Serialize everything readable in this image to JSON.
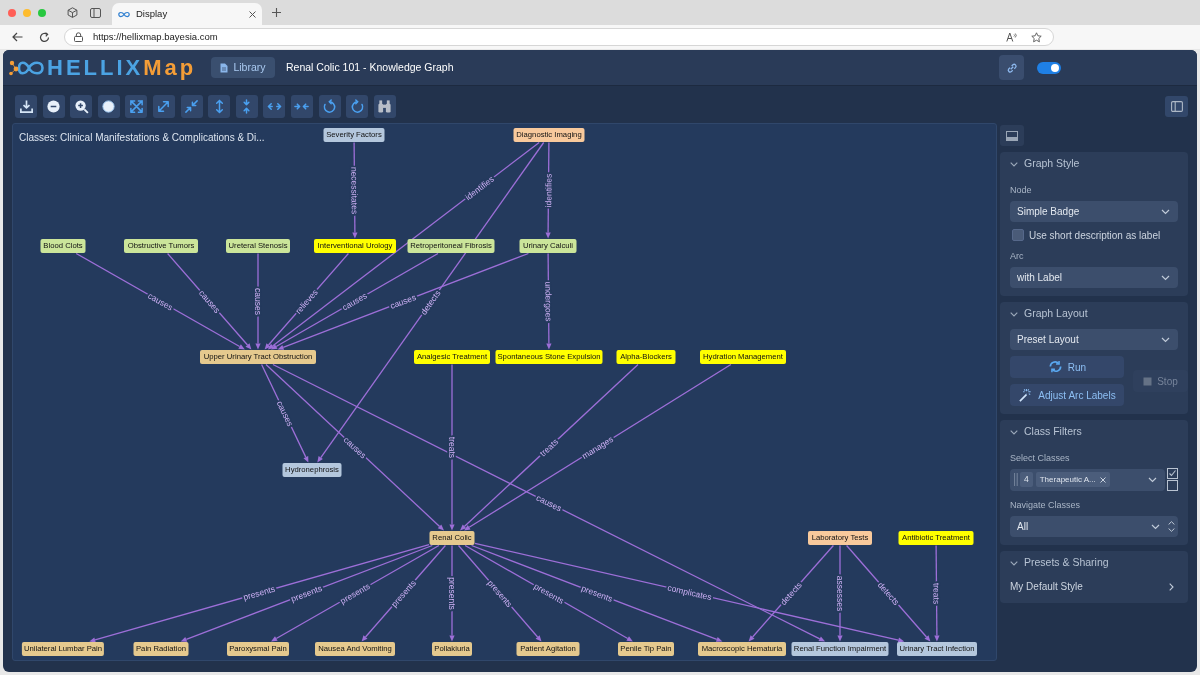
{
  "browser": {
    "tab": {
      "title": "Display"
    },
    "address": "https://hellixmap.bayesia.com"
  },
  "header": {
    "logo": {
      "text": "HELLIX",
      "accent": "Map"
    },
    "library_button": "Library",
    "title": "Renal Colic 101 - Knowledge Graph",
    "toggle": {
      "on": true
    }
  },
  "graph": {
    "caption": "Classes: Clinical Manifestations & Complications & Di...",
    "nodes": [
      {
        "label": "Severity Factors",
        "color": "#b4c7dd"
      },
      {
        "label": "Diagnostic Imaging",
        "color": "#f8c99c"
      },
      {
        "label": "Blood Clots",
        "color": "#cbe59a"
      },
      {
        "label": "Obstructive Tumors",
        "color": "#cbe59a"
      },
      {
        "label": "Ureteral Stenosis",
        "color": "#cbe59a"
      },
      {
        "label": "Interventional Urology",
        "color": "#ffff00"
      },
      {
        "label": "Retroperitoneal Fibrosis",
        "color": "#cbe59a"
      },
      {
        "label": "Urinary Calculi",
        "color": "#cbe59a"
      },
      {
        "label": "Upper Urinary Tract Obstruction",
        "color": "#e5c98e"
      },
      {
        "label": "Analgesic Treatment",
        "color": "#ffff00"
      },
      {
        "label": "Spontaneous Stone Expulsion",
        "color": "#ffff00"
      },
      {
        "label": "Alpha-Blockers",
        "color": "#ffff00"
      },
      {
        "label": "Hydration Management",
        "color": "#ffff00"
      },
      {
        "label": "Hydronephrosis",
        "color": "#b4c7dd"
      },
      {
        "label": "Renal Colic",
        "color": "#e5c98e"
      },
      {
        "label": "Laboratory Tests",
        "color": "#f8c99c"
      },
      {
        "label": "Antibiotic Treatment",
        "color": "#ffff00"
      },
      {
        "label": "Unilateral Lumbar Pain",
        "color": "#e5c98e"
      },
      {
        "label": "Pain Radiation",
        "color": "#e5c98e"
      },
      {
        "label": "Paroxysmal Pain",
        "color": "#e5c98e"
      },
      {
        "label": "Nausea And Vomiting",
        "color": "#e5c98e"
      },
      {
        "label": "Pollakiuria",
        "color": "#e5c98e"
      },
      {
        "label": "Patient Agitation",
        "color": "#e5c98e"
      },
      {
        "label": "Penile Tip Pain",
        "color": "#e5c98e"
      },
      {
        "label": "Macroscopic Hematuria",
        "color": "#e5c98e"
      },
      {
        "label": "Renal Function Impairment",
        "color": "#b4c7dd"
      },
      {
        "label": "Urinary Tract Infection",
        "color": "#b4c7dd"
      }
    ],
    "edges": [
      {
        "label": "necessitates"
      },
      {
        "label": "identifies"
      },
      {
        "label": "identifies"
      },
      {
        "label": "causes"
      },
      {
        "label": "causes"
      },
      {
        "label": "causes"
      },
      {
        "label": "relieves"
      },
      {
        "label": "causes"
      },
      {
        "label": "causes"
      },
      {
        "label": "detects"
      },
      {
        "label": "undergoes"
      },
      {
        "label": "causes"
      },
      {
        "label": "causes"
      },
      {
        "label": "treats"
      },
      {
        "label": "treats"
      },
      {
        "label": "manages"
      },
      {
        "label": "causes"
      },
      {
        "label": "presents"
      },
      {
        "label": "presents"
      },
      {
        "label": "presents"
      },
      {
        "label": "presents"
      },
      {
        "label": "presents"
      },
      {
        "label": "presents"
      },
      {
        "label": "presents"
      },
      {
        "label": "presents"
      },
      {
        "label": "complicates"
      },
      {
        "label": "detects"
      },
      {
        "label": "assesses"
      },
      {
        "label": "detects"
      },
      {
        "label": "treats"
      }
    ]
  },
  "side_panel": {
    "sections": [
      {
        "title": "Graph Style",
        "expanded": true,
        "controls": [
          {
            "kind": "select",
            "label": "Node",
            "value": "Simple Badge"
          },
          {
            "kind": "checkbox",
            "label": "Use short description as label",
            "checked": false
          },
          {
            "kind": "select",
            "label": "Arc",
            "value": "with Label"
          }
        ]
      },
      {
        "title": "Graph Layout",
        "expanded": true,
        "controls": [
          {
            "kind": "select",
            "value": "Preset Layout"
          },
          {
            "kind": "actions",
            "buttons": [
              {
                "label": "Run",
                "disabled": false
              },
              {
                "label": "Adjust Arc Labels",
                "disabled": false
              },
              {
                "label": "Stop",
                "disabled": true
              }
            ]
          }
        ]
      },
      {
        "title": "Class Filters",
        "expanded": true,
        "controls": [
          {
            "kind": "multiselect",
            "label": "Select Classes",
            "count": "4",
            "tags": [
              "Therapeutic A..."
            ]
          },
          {
            "kind": "select",
            "label": "Navigate Classes",
            "value": "All",
            "stepper": true
          }
        ]
      },
      {
        "title": "Presets & Sharing",
        "expanded": true,
        "controls": [
          {
            "kind": "link",
            "label": "My Default Style"
          }
        ]
      }
    ]
  }
}
